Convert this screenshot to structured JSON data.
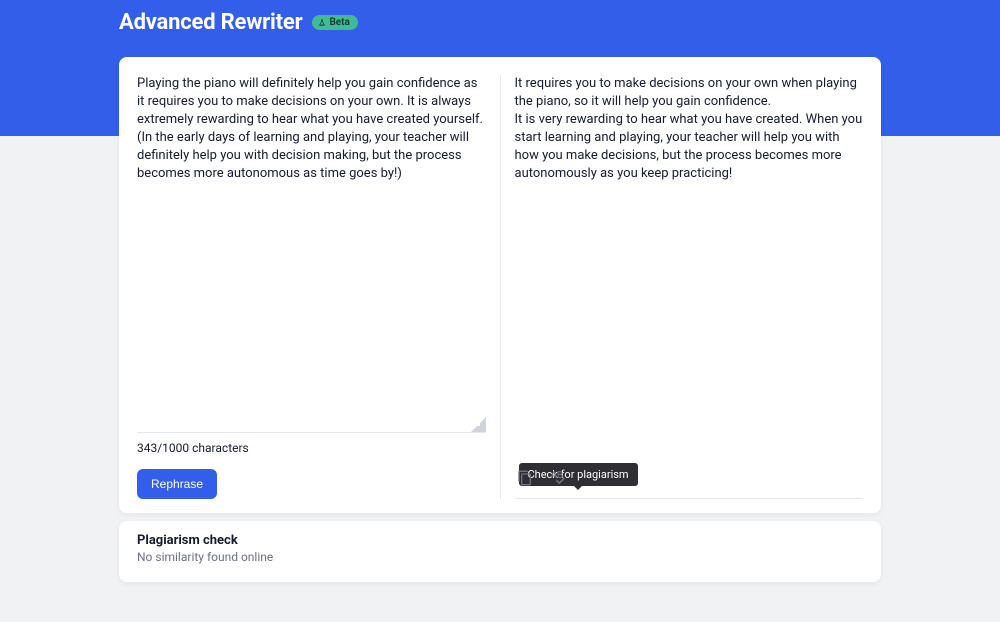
{
  "header": {
    "title": "Advanced Rewriter",
    "badge": "Beta"
  },
  "input": {
    "text": "Playing the piano will definitely help you gain confidence as it requires you to make decisions on your own. It is always extremely rewarding to hear what you have created yourself. (In the early days of learning and playing, your teacher will definitely help you with decision making, but the process becomes more autonomous as time goes by!)",
    "char_count_label": "343/1000 characters"
  },
  "output": {
    "paragraph1": "It requires you to make decisions on your own when playing the piano, so it will help you gain confidence.",
    "paragraph2": "It is very rewarding to hear what you have created. When you start learning and playing, your teacher will help you with how you make decisions, but the process becomes more autonomously as you keep practicing!"
  },
  "actions": {
    "rephrase_label": "Rephrase",
    "tooltip_plagiarism": "Check for plagiarism"
  },
  "plagiarism": {
    "title": "Plagiarism check",
    "subtitle": "No similarity found online"
  }
}
